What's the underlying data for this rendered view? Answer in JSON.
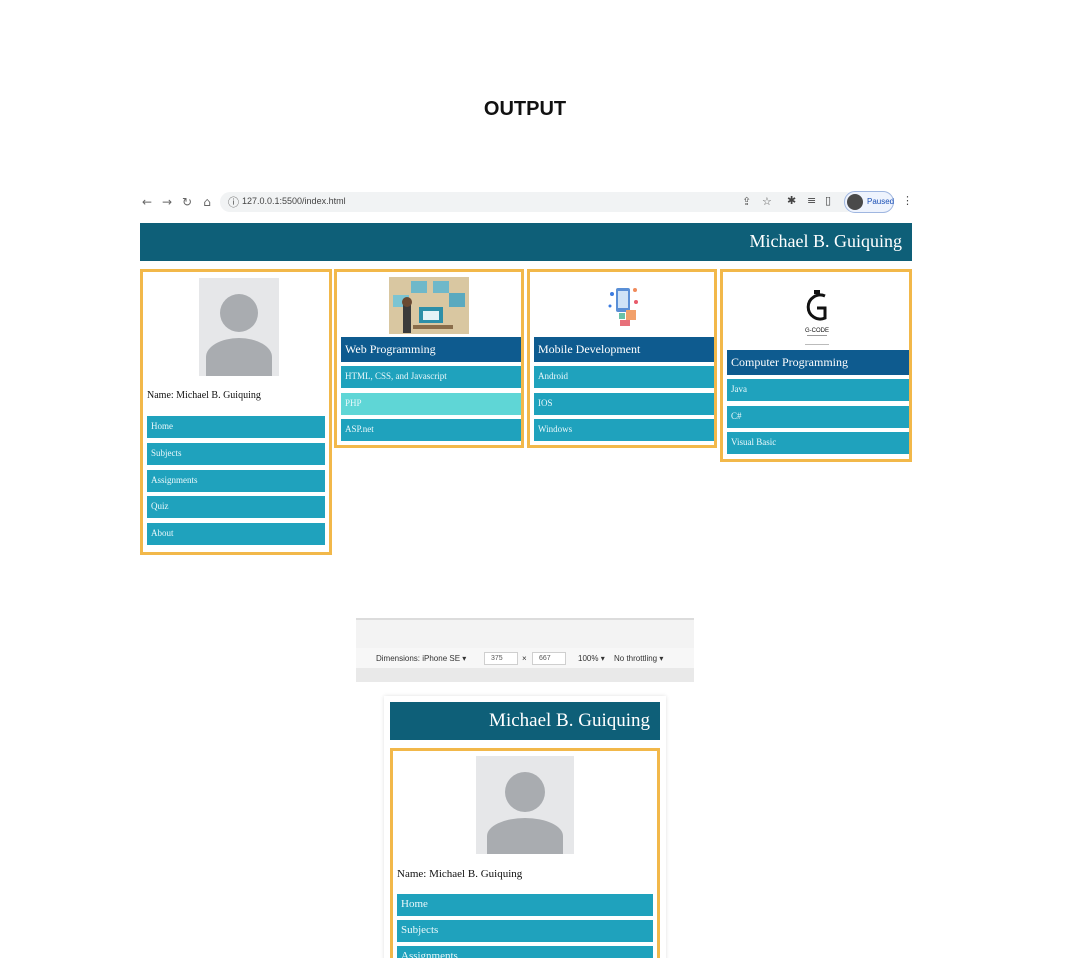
{
  "heading": "OUTPUT",
  "browser": {
    "url": "127.0.0.1:5500/index.html",
    "profile_status": "Paused",
    "icons": {
      "back": "back-arrow-icon",
      "forward": "forward-arrow-icon",
      "reload": "reload-icon",
      "home": "home-icon",
      "site_info": "info-icon",
      "share": "share-icon",
      "bookmark": "star-icon",
      "extensions": "puzzle-icon",
      "media": "media-icon",
      "sidepanel": "side-panel-icon",
      "menu": "kebab-menu-icon"
    }
  },
  "site": {
    "header_name": "Michael B. Guiquing",
    "profile": {
      "name_line": "Name: Michael B. Guiquing",
      "menu": [
        "Home",
        "Subjects",
        "Assignments",
        "Quiz",
        "About"
      ]
    },
    "cards": [
      {
        "title": "Web Programming",
        "items": [
          "HTML, CSS, and Javascript",
          "PHP",
          "ASP.net"
        ],
        "active_index": 1
      },
      {
        "title": "Mobile Development",
        "items": [
          "Android",
          "IOS",
          "Windows"
        ]
      },
      {
        "title": "Computer Programming",
        "items": [
          "Java",
          "C#",
          "Visual Basic"
        ],
        "logo_text": "G-CODE"
      }
    ]
  },
  "devtools": {
    "dimensions_label": "Dimensions: iPhone SE",
    "width": "375",
    "times": "×",
    "height": "667",
    "zoom": "100%",
    "throttling": "No throttling"
  },
  "mobile_menu_visible": [
    "Home",
    "Subjects",
    "Assignments"
  ],
  "colors": {
    "header": "#0e5f78",
    "menu_item": "#1fa2bd",
    "menu_item_active": "#5fd6d6",
    "card_title": "#0e5b8f",
    "card_border": "#f2b84a"
  }
}
